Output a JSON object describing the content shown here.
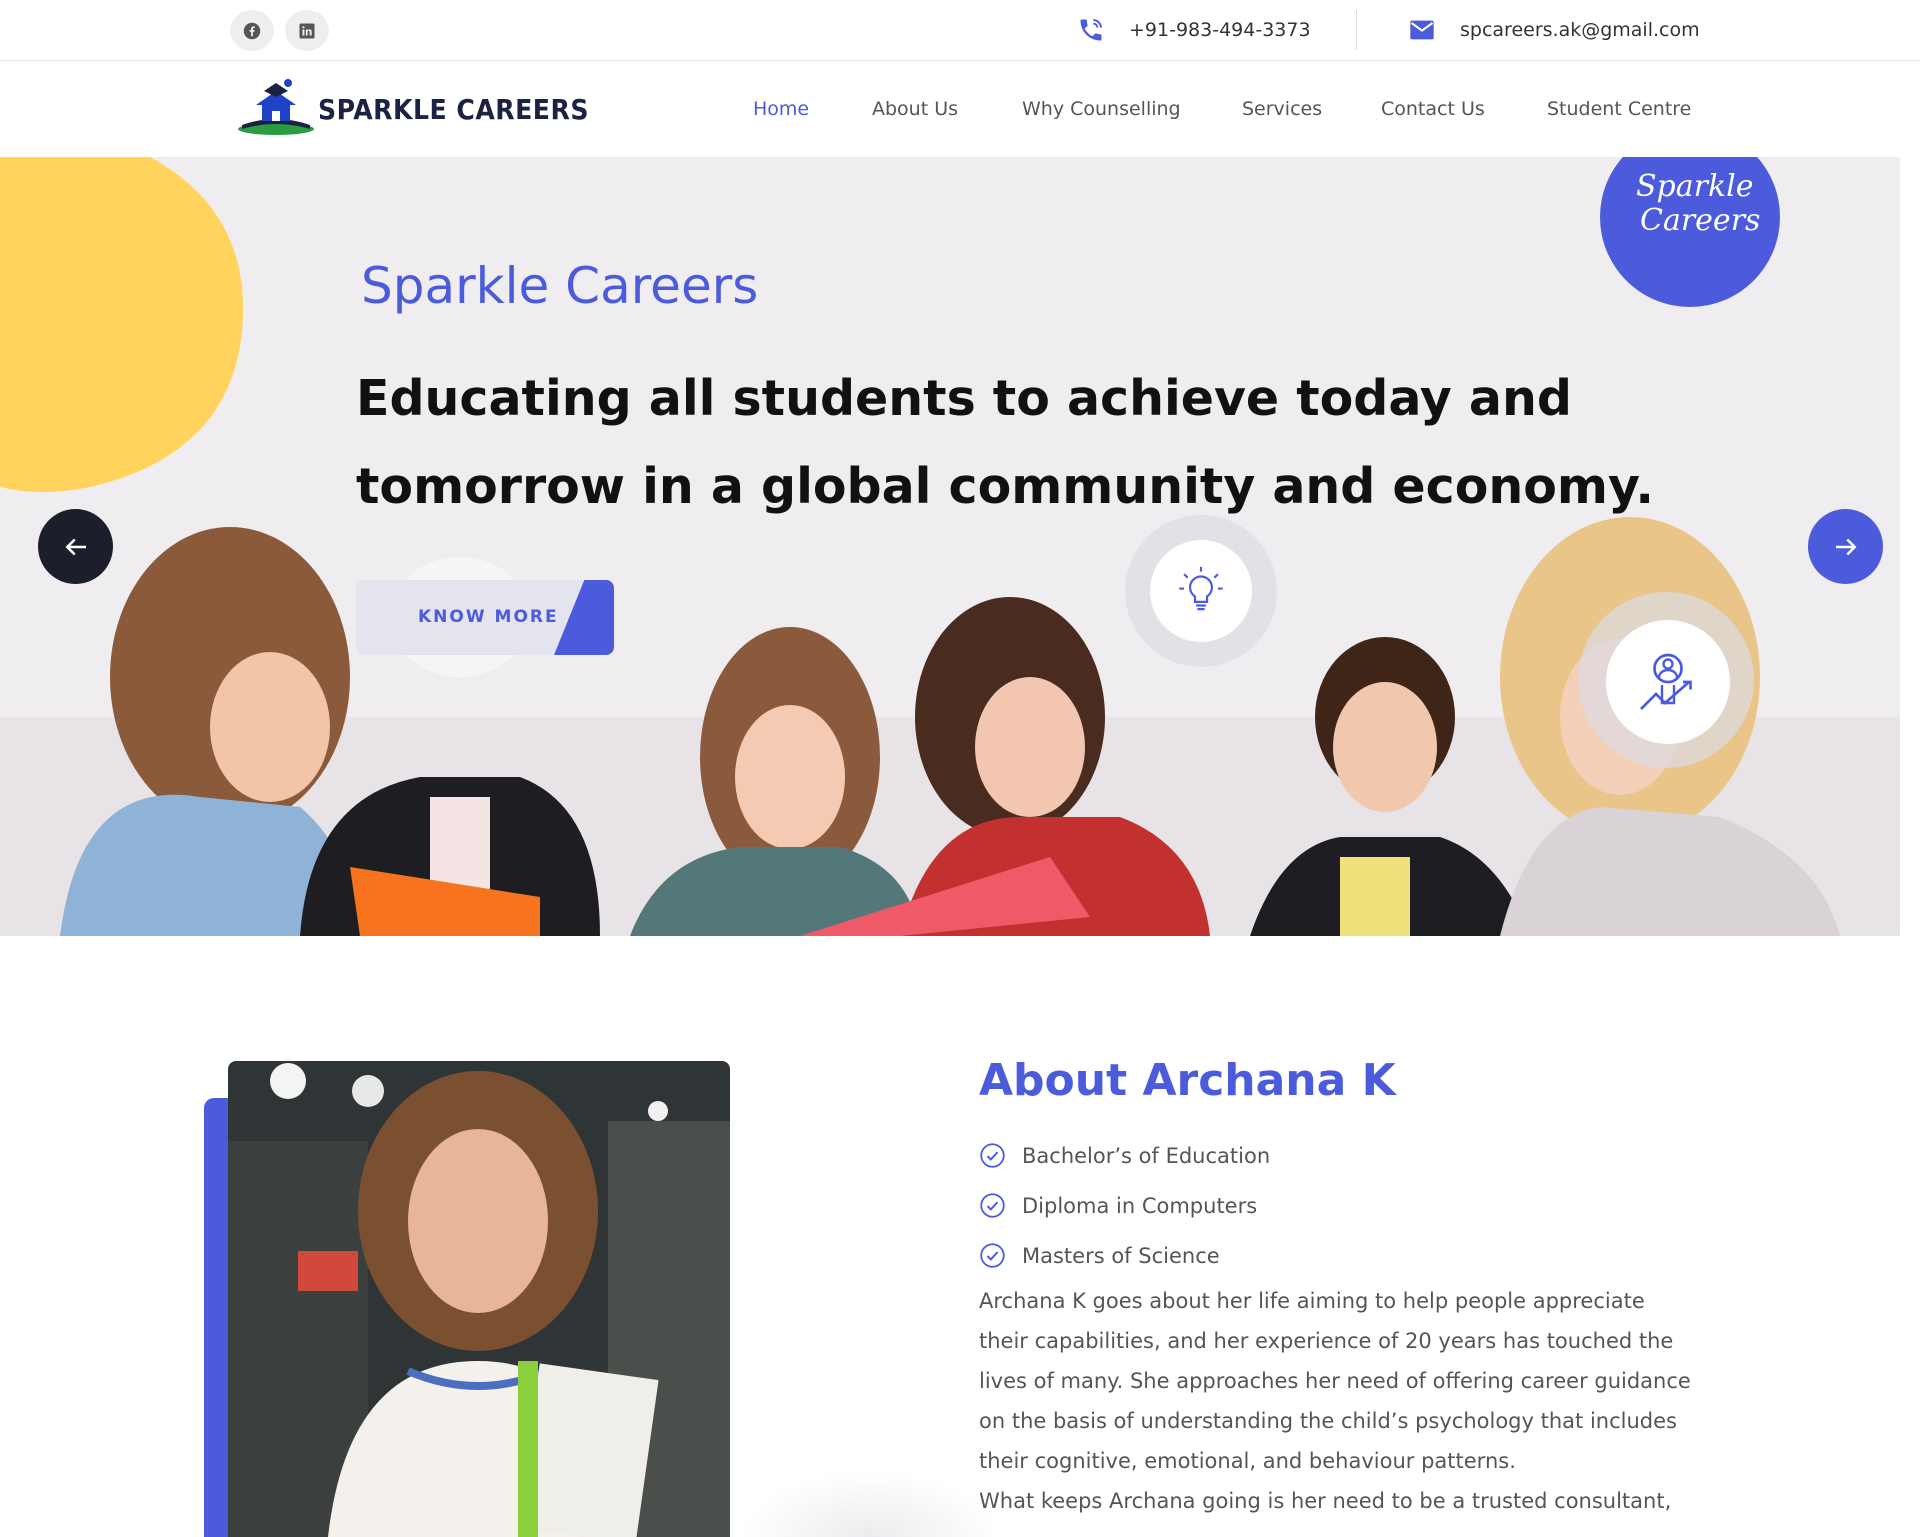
{
  "topbar": {
    "social": [
      {
        "name": "facebook",
        "icon": "facebook-icon"
      },
      {
        "name": "linkedin",
        "icon": "linkedin-icon"
      }
    ],
    "phone": "+91-983-494-3373",
    "email": "spcareers.ak@gmail.com"
  },
  "brand": {
    "name": "SPARKLE CAREERS",
    "accent": "#4b5bdb",
    "dark": "#1c2342",
    "yellow": "#ffd35c"
  },
  "nav": {
    "items": [
      "Home",
      "About Us",
      "Why Counselling",
      "Services",
      "Contact Us",
      "Student Centre"
    ],
    "active": "Home"
  },
  "hero": {
    "title": "Sparkle Careers",
    "headline": "Educating all students to achieve today and tomorrow in a global community and economy.",
    "cta": "KNOW MORE",
    "badge_line1": "Sparkle",
    "badge_line2": "Careers",
    "icons": [
      "lightbulb-icon",
      "growth-person-icon"
    ]
  },
  "about": {
    "title": "About Archana K",
    "qualifications": [
      "Bachelor’s of Education",
      "Diploma in Computers",
      "Masters of Science"
    ],
    "bio_1": "Archana K goes about her life aiming to help people appreciate their capabilities, and her experience of 20 years has touched the lives of many. She approaches her need of offering career guidance on the basis of understanding the child’s psychology that includes their cognitive, emotional, and behaviour patterns.",
    "bio_2": "What keeps Archana going is her need to be a trusted consultant,"
  }
}
